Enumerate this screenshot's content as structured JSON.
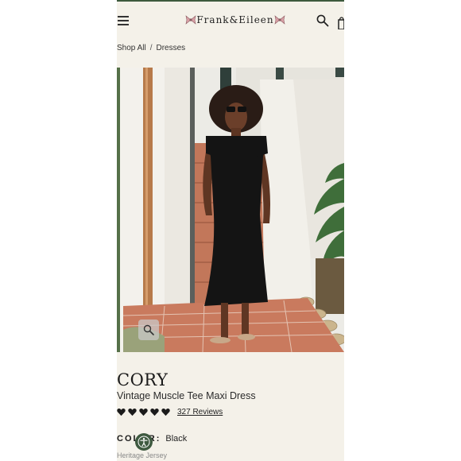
{
  "header": {
    "menu_icon": "hamburger-icon",
    "logo": "Frank&Eileen",
    "search_icon": "search-icon",
    "bag_icon": "shopping-bag-icon"
  },
  "breadcrumb": {
    "items": [
      "Shop All",
      "Dresses"
    ],
    "separator": "/"
  },
  "product": {
    "name": "CORY",
    "subtitle": "Vintage Muscle Tee Maxi Dress",
    "rating": 5,
    "reviews_label": "327 Reviews",
    "color_label": "COLOR:",
    "color_value": "Black",
    "fabric": "Heritage Jersey",
    "image_zoom_icon": "magnifier-icon"
  },
  "accessibility": {
    "icon": "accessibility-icon",
    "color": "#3e5a40"
  },
  "colors": {
    "background": "#f4f1e9",
    "brand_green": "#3d5a3d",
    "text": "#1e1e1e"
  }
}
